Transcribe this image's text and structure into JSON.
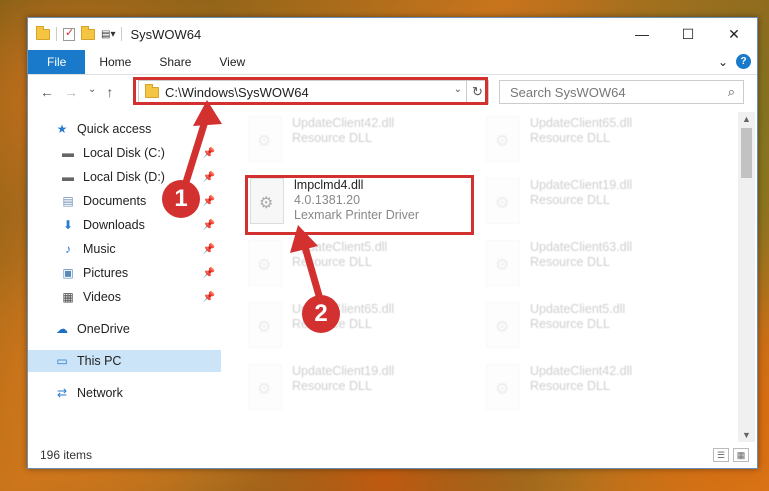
{
  "window": {
    "title": "SysWOW64",
    "minimize": "—",
    "maximize": "☐",
    "close": "✕"
  },
  "ribbon": {
    "tabs": [
      "File",
      "Home",
      "Share",
      "View"
    ],
    "chevron": "⌄",
    "help": "?"
  },
  "nav": {
    "back": "←",
    "forward": "→",
    "recent": "⌄",
    "up": "↑"
  },
  "address": {
    "path": "C:\\Windows\\SysWOW64",
    "dropdown": "⌄",
    "refresh": "↻"
  },
  "search": {
    "placeholder": "Search SysWOW64",
    "icon": "⌕"
  },
  "sidebar": {
    "items": [
      {
        "label": "Quick access",
        "icon": "star-icon",
        "glyph": "★",
        "pinned": false
      },
      {
        "label": "Local Disk (C:)",
        "icon": "drive-icon",
        "glyph": "▬",
        "pinned": true
      },
      {
        "label": "Local Disk (D:)",
        "icon": "drive-icon",
        "glyph": "▬",
        "pinned": true
      },
      {
        "label": "Documents",
        "icon": "documents-icon",
        "glyph": "▤",
        "pinned": true
      },
      {
        "label": "Downloads",
        "icon": "download-icon",
        "glyph": "⬇",
        "pinned": true
      },
      {
        "label": "Music",
        "icon": "music-icon",
        "glyph": "♪",
        "pinned": true
      },
      {
        "label": "Pictures",
        "icon": "pictures-icon",
        "glyph": "▣",
        "pinned": true
      },
      {
        "label": "Videos",
        "icon": "videos-icon",
        "glyph": "▦",
        "pinned": true
      },
      {
        "label": "OneDrive",
        "icon": "cloud-icon",
        "glyph": "☁",
        "pinned": false
      },
      {
        "label": "This PC",
        "icon": "computer-icon",
        "glyph": "▭",
        "pinned": false
      },
      {
        "label": "Network",
        "icon": "network-icon",
        "glyph": "⇄",
        "pinned": false
      }
    ],
    "pin_glyph": "📌"
  },
  "files": [
    {
      "name": "UpdateClient42.dll",
      "line2": "Resource DLL",
      "line3": "",
      "faded": true
    },
    {
      "name": "UpdateClient65.dll",
      "line2": "Resource DLL",
      "line3": "",
      "faded": true
    },
    {
      "name": "lmpclmd4.dll",
      "line2": "4.0.1381.20",
      "line3": "Lexmark Printer Driver",
      "faded": false
    },
    {
      "name": "UpdateClient19.dll",
      "line2": "Resource DLL",
      "line3": "",
      "faded": true
    },
    {
      "name": "UpdateClient5.dll",
      "line2": "Resource DLL",
      "line3": "",
      "faded": true
    },
    {
      "name": "UpdateClient63.dll",
      "line2": "Resource DLL",
      "line3": "",
      "faded": true
    },
    {
      "name": "UpdateClient65.dll",
      "line2": "Resource DLL",
      "line3": "",
      "faded": true
    },
    {
      "name": "UpdateClient5.dll",
      "line2": "Resource DLL",
      "line3": "",
      "faded": true
    },
    {
      "name": "UpdateClient19.dll",
      "line2": "Resource DLL",
      "line3": "",
      "faded": true
    },
    {
      "name": "UpdateClient42.dll",
      "line2": "Resource DLL",
      "line3": "",
      "faded": true
    }
  ],
  "status": {
    "count": "196 items",
    "view_details": "☰",
    "view_tiles": "▦"
  },
  "annotations": {
    "badge1": "1",
    "badge2": "2",
    "color": "#d33030"
  }
}
